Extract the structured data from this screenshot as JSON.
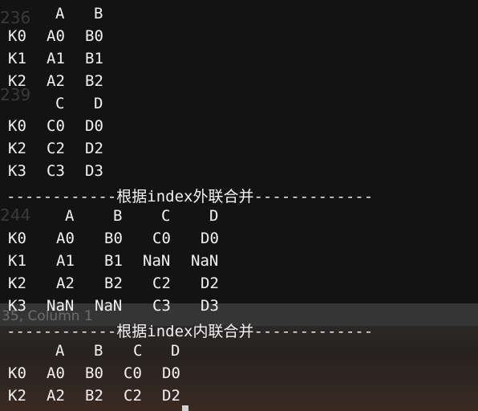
{
  "gutter": {
    "line_numbers": [
      "236",
      "239",
      "244"
    ]
  },
  "status_bar": {
    "text": "35, Column 1"
  },
  "output": {
    "left_df": {
      "header": [
        "A",
        "B"
      ],
      "rows": [
        {
          "index": "K0",
          "cells": [
            "A0",
            "B0"
          ]
        },
        {
          "index": "K1",
          "cells": [
            "A1",
            "B1"
          ]
        },
        {
          "index": "K2",
          "cells": [
            "A2",
            "B2"
          ]
        }
      ]
    },
    "right_df": {
      "header": [
        "C",
        "D"
      ],
      "rows": [
        {
          "index": "K0",
          "cells": [
            "C0",
            "D0"
          ]
        },
        {
          "index": "K2",
          "cells": [
            "C2",
            "D2"
          ]
        },
        {
          "index": "K3",
          "cells": [
            "C3",
            "D3"
          ]
        }
      ]
    },
    "outer_sep": "------------根据index外联合并-------------",
    "outer_df": {
      "header": [
        "A",
        "B",
        "C",
        "D"
      ],
      "rows": [
        {
          "index": "K0",
          "cells": [
            "A0",
            "B0",
            "C0",
            "D0"
          ]
        },
        {
          "index": "K1",
          "cells": [
            "A1",
            "B1",
            "NaN",
            "NaN"
          ]
        },
        {
          "index": "K2",
          "cells": [
            "A2",
            "B2",
            "C2",
            "D2"
          ]
        },
        {
          "index": "K3",
          "cells": [
            "NaN",
            "NaN",
            "C3",
            "D3"
          ]
        }
      ]
    },
    "inner_sep": "------------根据index内联合并-------------",
    "inner_df": {
      "header": [
        "A",
        "B",
        "C",
        "D"
      ],
      "rows": [
        {
          "index": "K0",
          "cells": [
            "A0",
            "B0",
            "C0",
            "D0"
          ]
        },
        {
          "index": "K2",
          "cells": [
            "A2",
            "B2",
            "C2",
            "D2"
          ]
        }
      ]
    }
  }
}
